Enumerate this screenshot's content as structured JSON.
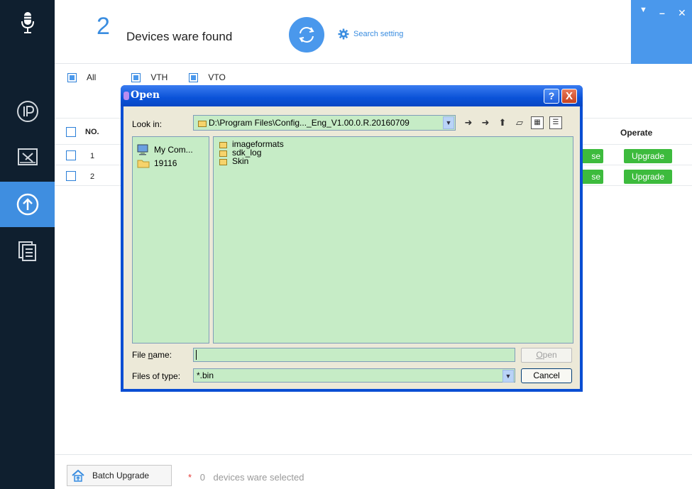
{
  "header": {
    "device_count": "2",
    "found_label": "Devices ware found",
    "search_setting": "Search setting"
  },
  "filters": [
    {
      "label": "All"
    },
    {
      "label": "VTH"
    },
    {
      "label": "VTO"
    }
  ],
  "table": {
    "columns": {
      "no": "NO.",
      "operate": "Operate"
    },
    "rows": [
      {
        "no": "1",
        "browse": "se",
        "upgrade": "Upgrade"
      },
      {
        "no": "2",
        "browse": "se",
        "upgrade": "Upgrade"
      }
    ]
  },
  "footer": {
    "batch_upgrade": "Batch Upgrade",
    "star": "*",
    "selected_count": "0",
    "selected_text": "devices ware selected"
  },
  "dialog": {
    "title": "Open",
    "look_in_label": "Look in:",
    "look_in_path": "D:\\Program Files\\Config..._Eng_V1.00.0.R.20160709",
    "places": [
      {
        "label": "My Com...",
        "icon": "my-computer-icon"
      },
      {
        "label": "19116",
        "icon": "folder-icon"
      }
    ],
    "files": [
      {
        "name": "imageformats"
      },
      {
        "name": "sdk_log"
      },
      {
        "name": "Skin"
      }
    ],
    "file_name_label_pre": "File ",
    "file_name_label_u": "n",
    "file_name_label_post": "ame:",
    "file_name_value": "",
    "files_of_type_label": "Files of type:",
    "files_of_type_value": "*.bin",
    "open_pre": "",
    "open_u": "O",
    "open_post": "pen",
    "cancel": "Cancel",
    "help": "?",
    "close": "X"
  },
  "colors": {
    "sidebar": "#0f1f2f",
    "accent": "#4a98ec",
    "green": "#3dbb3d",
    "dialog_fill": "#c6ecc6"
  }
}
